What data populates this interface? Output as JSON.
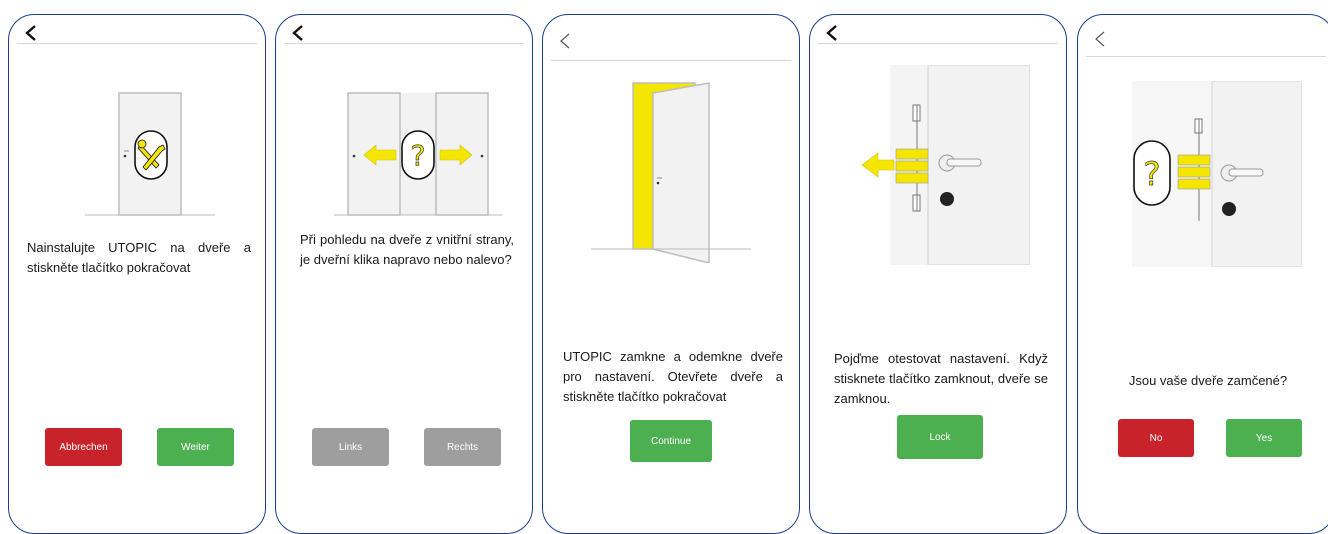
{
  "colors": {
    "frame": "#1c3f8c",
    "red": "#c8232a",
    "green": "#4caf50",
    "gray": "#9e9e9e",
    "yellow": "#f5e600",
    "door": "#f2f2f2"
  },
  "screens": [
    {
      "back_icon": "chevron-left-icon",
      "instruction": "Nainstalujte UTOPIC na dveře a stiskněte tlačítko pokračovat",
      "buttons": [
        {
          "label": "Abbrechen",
          "color": "red"
        },
        {
          "label": "Weiter",
          "color": "green"
        }
      ]
    },
    {
      "back_icon": "chevron-left-icon",
      "instruction": "Při pohledu na dveře z vnitřní strany, je dveřní klika napravo nebo nalevo?",
      "buttons": [
        {
          "label": "Links",
          "color": "gray"
        },
        {
          "label": "Rechts",
          "color": "gray"
        }
      ]
    },
    {
      "back_icon": "chevron-left-icon",
      "instruction": "UTOPIC zamkne a odemkne dveře pro nastavení. Otevřete dveře a stiskněte tlačítko pokračovat",
      "buttons": [
        {
          "label": "Continue",
          "color": "green"
        }
      ]
    },
    {
      "back_icon": "chevron-left-icon",
      "instruction": "Pojďme otestovat nastavení. Když stisknete tlačítko zamknout, dveře se zamknou.",
      "buttons": [
        {
          "label": "Lock",
          "color": "green"
        }
      ]
    },
    {
      "back_icon": "chevron-left-icon",
      "instruction": "Jsou vaše dveře zamčené?",
      "buttons": [
        {
          "label": "No",
          "color": "red"
        },
        {
          "label": "Yes",
          "color": "green"
        }
      ]
    }
  ]
}
